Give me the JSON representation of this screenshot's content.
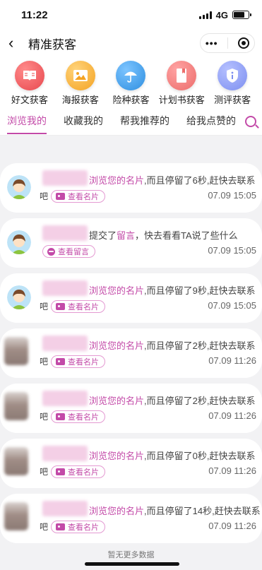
{
  "status": {
    "time": "11:22",
    "network": "4G"
  },
  "nav": {
    "title": "精准获客"
  },
  "categories": [
    {
      "label": "好文获客",
      "icon": "book-icon",
      "color": "#e8484e"
    },
    {
      "label": "海报获客",
      "icon": "image-icon",
      "color": "#f4a323"
    },
    {
      "label": "险种获客",
      "icon": "umbrella-icon",
      "color": "#2f8fe0"
    },
    {
      "label": "计划书获客",
      "icon": "document-icon",
      "color": "#ec6d6b"
    },
    {
      "label": "测评获客",
      "icon": "info-shield-icon",
      "color": "#7d8ff0"
    }
  ],
  "tabs": [
    "浏览我的",
    "收藏我的",
    "帮我推荐的",
    "给我点赞的"
  ],
  "accent": "#c34aa8",
  "cards": [
    {
      "avatar": "cartoon",
      "pre": "浏览您的名片",
      "post": ",而且停留了6秒,赶快去联系",
      "ba": "吧",
      "action": "查看名片",
      "time": "07.09 15:05"
    },
    {
      "avatar": "cartoon",
      "pre_plain": "提交了",
      "pre": "留言",
      "post": "，快去看看TA说了些什么",
      "ba": "",
      "action": "查看留言",
      "time": "07.09 15:05"
    },
    {
      "avatar": "cartoon",
      "pre": "浏览您的名片",
      "post": ",而且停留了9秒,赶快去联系",
      "ba": "吧",
      "action": "查看名片",
      "time": "07.09 15:05"
    },
    {
      "avatar": "photo",
      "pre": "浏览您的名片",
      "post": ",而且停留了2秒,赶快去联系",
      "ba": "吧",
      "action": "查看名片",
      "time": "07.09 11:26"
    },
    {
      "avatar": "photo",
      "pre": "浏览您的名片",
      "post": ",而且停留了2秒,赶快去联系",
      "ba": "吧",
      "action": "查看名片",
      "time": "07.09 11:26"
    },
    {
      "avatar": "photo",
      "pre": "浏览您的名片",
      "post": ",而且停留了0秒,赶快去联系",
      "ba": "吧",
      "action": "查看名片",
      "time": "07.09 11:26"
    },
    {
      "avatar": "photo",
      "pre": "浏览您的名片",
      "post": ",而且停留了14秒,赶快去联系",
      "ba": "吧",
      "action": "查看名片",
      "time": "07.09 11:26"
    }
  ],
  "footer": "暂无更多数据"
}
